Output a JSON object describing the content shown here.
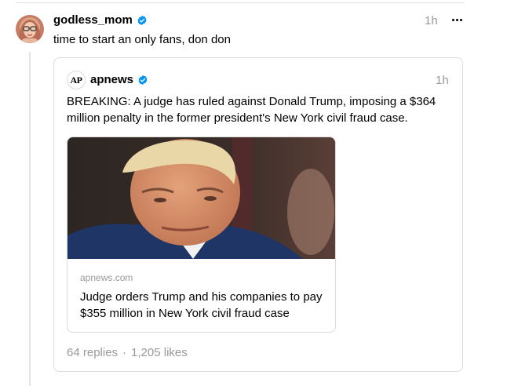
{
  "post": {
    "author": "godless_mom",
    "time": "1h",
    "text": "time to start an only fans, don don"
  },
  "quote": {
    "author": "apnews",
    "avatar_text": "AP",
    "time": "1h",
    "text": "BREAKING: A judge has ruled against Donald Trump, imposing a $364 million penalty in the former president's New York civil fraud case.",
    "link": {
      "domain": "apnews.com",
      "title": "Judge orders Trump and his companies to pay $355 million in New York civil fraud case"
    },
    "replies": "64 replies",
    "separator": "·",
    "likes": "1,205 likes"
  },
  "icons": {
    "verified": "verified-badge-icon",
    "more": "more-horizontal-icon"
  },
  "colors": {
    "verified": "#0095f6",
    "muted": "#999999",
    "border": "#dcdcdc"
  }
}
